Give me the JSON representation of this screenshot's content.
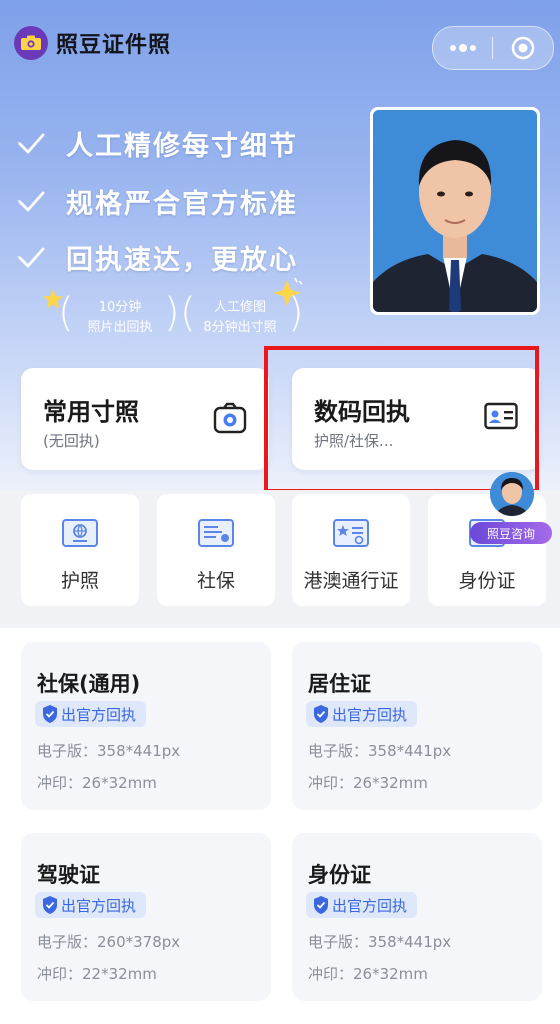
{
  "app": {
    "title": "照豆证件照"
  },
  "hero": {
    "slogans": [
      "人工精修每寸细节",
      "规格严合官方标准",
      "回执速达，更放心"
    ],
    "badges": [
      {
        "line1": "10分钟",
        "line2": "照片出回执"
      },
      {
        "line1": "人工修图",
        "line2": "8分钟出寸照"
      }
    ]
  },
  "cards": [
    {
      "title": "常用寸照",
      "sub": "(无回执)",
      "icon": "camera-icon"
    },
    {
      "title": "数码回执",
      "sub": "护照/社保...",
      "icon": "id-card-icon"
    }
  ],
  "categories": [
    {
      "label": "护照",
      "icon": "passport-icon"
    },
    {
      "label": "社保",
      "icon": "social-security-card-icon"
    },
    {
      "label": "港澳通行证",
      "icon": "permit-icon"
    },
    {
      "label": "身份证",
      "icon": "id-card-icon"
    }
  ],
  "consult": {
    "label": "照豆咨询"
  },
  "products": [
    {
      "title": "社保(通用)",
      "tag": "出官方回执",
      "digital": "电子版：358*441px",
      "print": "冲印：26*32mm"
    },
    {
      "title": "居住证",
      "tag": "出官方回执",
      "digital": "电子版：358*441px",
      "print": "冲印：26*32mm"
    },
    {
      "title": "驾驶证",
      "tag": "出官方回执",
      "digital": "电子版：260*378px",
      "print": "冲印：22*32mm"
    },
    {
      "title": "身份证",
      "tag": "出官方回执",
      "digital": "电子版：358*441px",
      "print": "冲印：26*32mm"
    }
  ],
  "colors": {
    "accent": "#3b68e0",
    "highlight": "#e8181c",
    "brand": "#6b3ab8"
  }
}
